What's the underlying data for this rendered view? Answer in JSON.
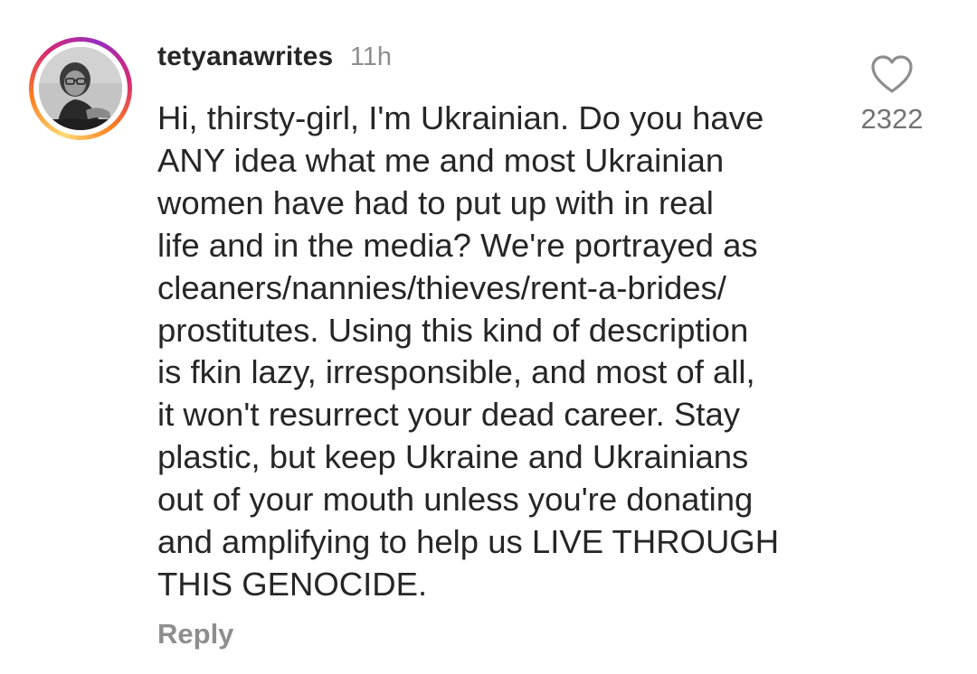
{
  "comment": {
    "username": "tetyanawrites",
    "time": "11h",
    "text_lines": [
      "Hi, thirsty-girl, I'm Ukrainian. Do you have",
      "ANY idea what me and most Ukrainian",
      "women have had to put up with in real",
      "life and in the media? We're portrayed as",
      "cleaners/nannies/thieves/rent-a-brides/",
      "prostitutes. Using this kind of description",
      "is fkin lazy, irresponsible, and most of all,",
      "it won't resurrect your dead career. Stay",
      "plastic, but keep Ukraine and Ukrainians",
      "out of your mouth unless you're donating",
      "and amplifying to help us LIVE THROUGH",
      "THIS GENOCIDE."
    ],
    "reply_label": "Reply",
    "like_count": "2322",
    "like_icon": "heart-outline-icon",
    "avatar_ring_colors": [
      "#feda75",
      "#fa7e1e",
      "#d62976",
      "#962fbf"
    ]
  }
}
